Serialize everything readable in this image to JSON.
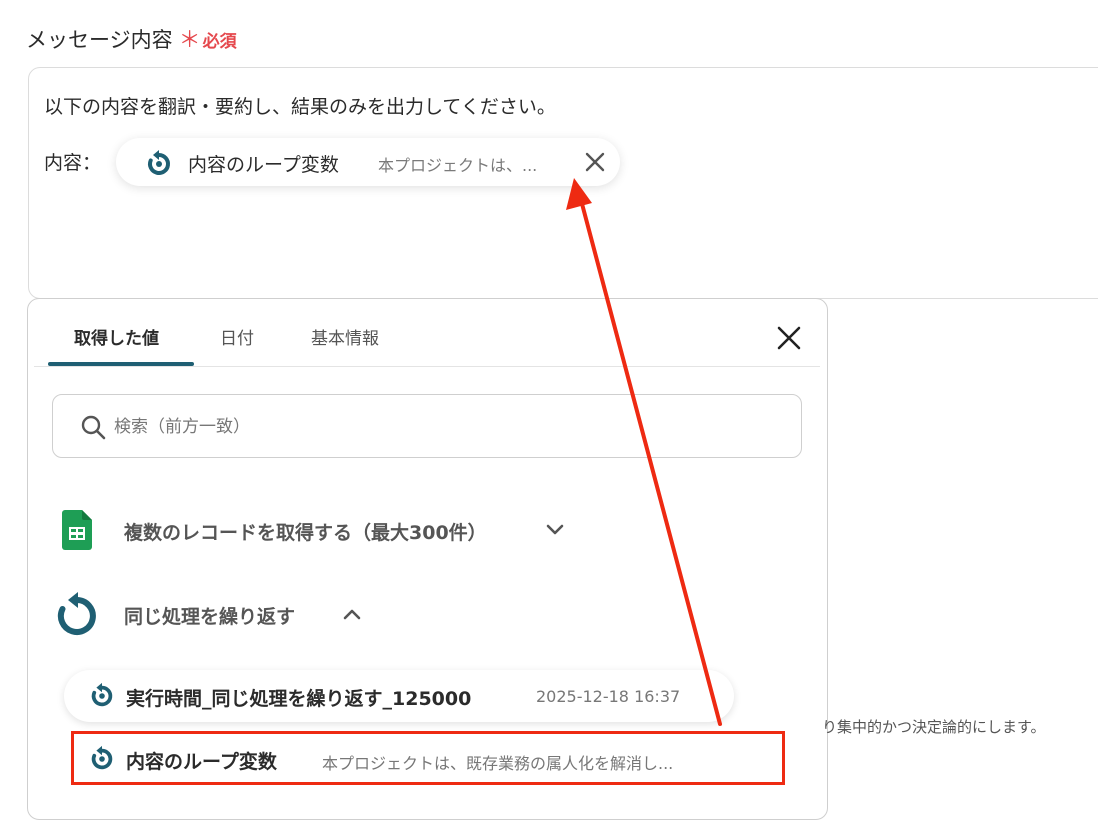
{
  "field": {
    "label": "メッセージ内容",
    "required_mark": "＊",
    "required_text": "必須"
  },
  "message": {
    "line1": "以下の内容を翻訳・要約し、結果のみを出力してください。",
    "prefix": "内容：",
    "chip": {
      "name": "内容のループ変数",
      "preview": "本プロジェクトは、...",
      "icon": "loop-icon"
    }
  },
  "panel": {
    "tabs": [
      {
        "label": "取得した値",
        "active": true
      },
      {
        "label": "日付",
        "active": false
      },
      {
        "label": "基本情報",
        "active": false
      }
    ],
    "search_placeholder": "検索（前方一致）",
    "sections": [
      {
        "title": "複数のレコードを取得する（最大300件）",
        "icon": "google-sheets-icon",
        "expanded": false
      },
      {
        "title": "同じ処理を繰り返す",
        "icon": "loop-icon",
        "expanded": true
      }
    ],
    "items": [
      {
        "name": "実行時間_同じ処理を繰り返す_125000",
        "meta": "2025-12-18 16:37"
      },
      {
        "name": "内容のループ変数",
        "meta": "本プロジェクトは、既存業務の属人化を解消し..."
      }
    ]
  },
  "background_text": "り集中的かつ決定論的にします。",
  "colors": {
    "accent": "#1f5f73",
    "required": "#e5484d",
    "annotation": "#ee2a12",
    "sheets_green": "#1e9e55"
  }
}
